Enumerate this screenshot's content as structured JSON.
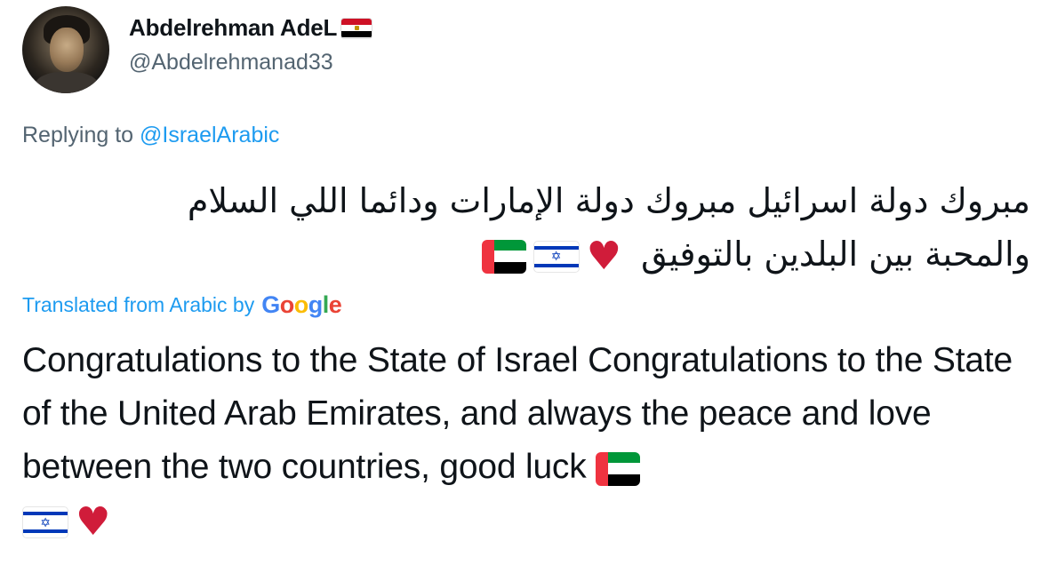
{
  "author": {
    "display_name": "Abdelrehman AdeL",
    "handle": "@Abdelrehmanad33",
    "name_flag_icon": "egypt-flag-icon"
  },
  "reply": {
    "prefix": "Replying to",
    "mention": "@IsraelArabic"
  },
  "tweet": {
    "arabic_text": "مبروك دولة اسرائيل مبروك دولة الإمارات ودائما اللي السلام والمحبة بين البلدين بالتوفيق",
    "emojis": [
      "uae-flag-icon",
      "israel-flag-icon",
      "red-heart-icon"
    ]
  },
  "translation": {
    "label": "Translated from Arabic by",
    "provider_letters": [
      "G",
      "o",
      "o",
      "g",
      "l",
      "e"
    ],
    "text": "Congratulations to the State of Israel Congratulations to the State of the United Arab Emirates, and always the peace and love between the two countries, good luck"
  },
  "colors": {
    "link_blue": "#1d9bf0",
    "secondary_text": "#536471",
    "heart_red": "#d01c3a"
  }
}
